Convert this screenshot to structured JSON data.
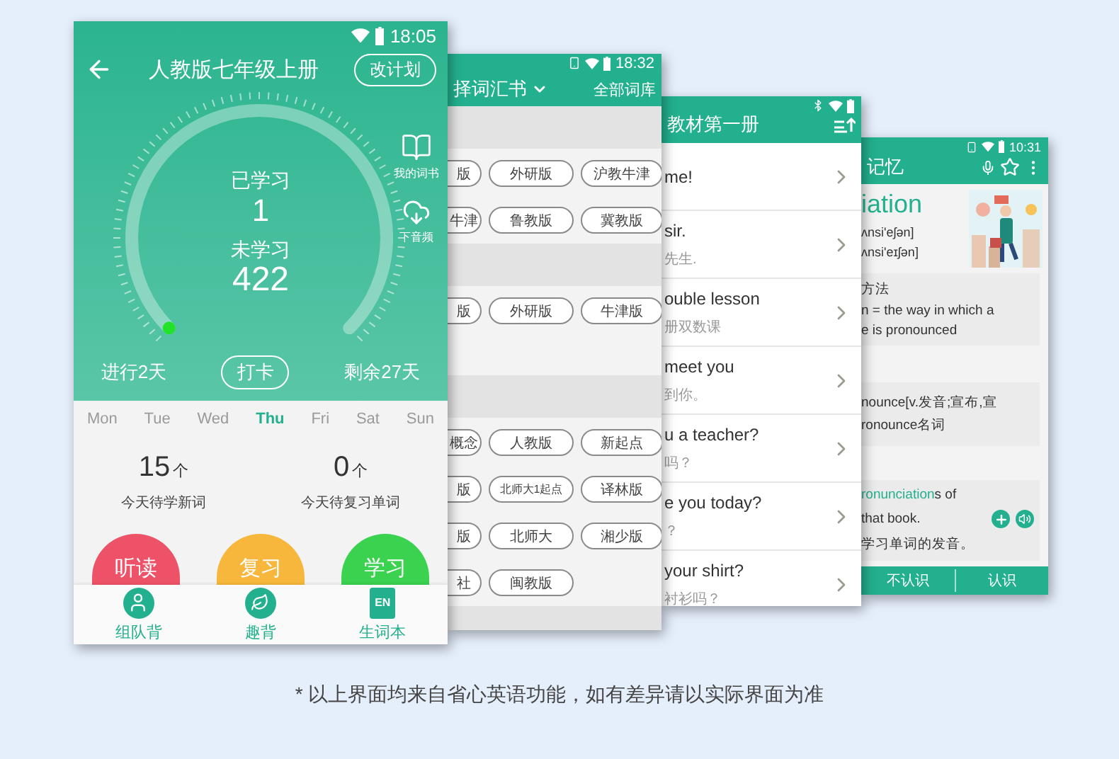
{
  "plan_screen": {
    "status_time": "18:05",
    "title": "人教版七年级上册",
    "plan_button": "改计划",
    "side_links": [
      {
        "label": "我的词书"
      },
      {
        "label": "下音频"
      }
    ],
    "gauge": {
      "learned_label": "已学习",
      "learned": "1",
      "unlearned_label": "未学习",
      "unlearned": "422"
    },
    "days_done": "进行2天",
    "checkin_button": "打卡",
    "days_left": "剩余27天",
    "weekdays": [
      {
        "label": "Mon",
        "selected": false
      },
      {
        "label": "Tue",
        "selected": false
      },
      {
        "label": "Wed",
        "selected": false
      },
      {
        "label": "Thu",
        "selected": true
      },
      {
        "label": "Fri",
        "selected": false
      },
      {
        "label": "Sat",
        "selected": false
      },
      {
        "label": "Sun",
        "selected": false
      }
    ],
    "stats": [
      {
        "value": "15",
        "unit": "个",
        "label": "今天待学新词"
      },
      {
        "value": "0",
        "unit": "个",
        "label": "今天待复习单词"
      }
    ],
    "actions": [
      {
        "label": "听读",
        "color": "#ee5268"
      },
      {
        "label": "复习",
        "color": "#f6b73c"
      },
      {
        "label": "学习",
        "color": "#3bd24f"
      }
    ],
    "nav": [
      {
        "label": "组队背"
      },
      {
        "label": "趣背"
      },
      {
        "label": "生词本",
        "badge": "EN"
      }
    ]
  },
  "book_screen": {
    "title": "择词汇书",
    "status_time": "18:32",
    "library_link": "全部词库",
    "sections": [
      {
        "chips": [
          "版",
          "外研版",
          "沪教牛津",
          "牛津",
          "鲁教版",
          "冀教版"
        ]
      },
      {
        "chips": [
          "版",
          "外研版",
          "牛津版"
        ]
      },
      {
        "chips": [
          "概念",
          "人教版",
          "新起点",
          "版",
          "北师大1起点",
          "译林版",
          "版",
          "北师大",
          "湘少版",
          "社",
          "闽教版"
        ]
      }
    ]
  },
  "lesson_screen": {
    "title": "教材第一册",
    "lessons": [
      {
        "en": "me!"
      },
      {
        "en": "sir.",
        "zh": "先生."
      },
      {
        "en": "ouble lesson",
        "zh": "册双数课"
      },
      {
        "en": "meet you",
        "zh": "到你。"
      },
      {
        "en": "u a teacher?",
        "zh": "吗？"
      },
      {
        "en": "e you today?",
        "zh": "？"
      },
      {
        "en": "your shirt?",
        "zh": "衬衫吗？"
      }
    ]
  },
  "word_screen": {
    "title": "记忆",
    "status_time": "10:31",
    "word": "iation",
    "phonetics": [
      "ʌnsi'eʃən]",
      "ʌnsi'eɪʃən]"
    ],
    "picture": {
      "kind": "picture"
    },
    "definition": [
      "方法",
      "n = the way in which a",
      "e is pronounced"
    ],
    "etymology": [
      "nounce[v.发音;宣布,宣",
      "ronounce名词"
    ],
    "example": {
      "highlight": "ronunciation",
      "rest": "s of",
      "line2": "that book.",
      "zh": "学习单词的发音。"
    },
    "buttons": [
      "不认识",
      "认识"
    ]
  },
  "footnote": "* 以上界面均来自省心英语功能，如有差异请以实际界面为准"
}
